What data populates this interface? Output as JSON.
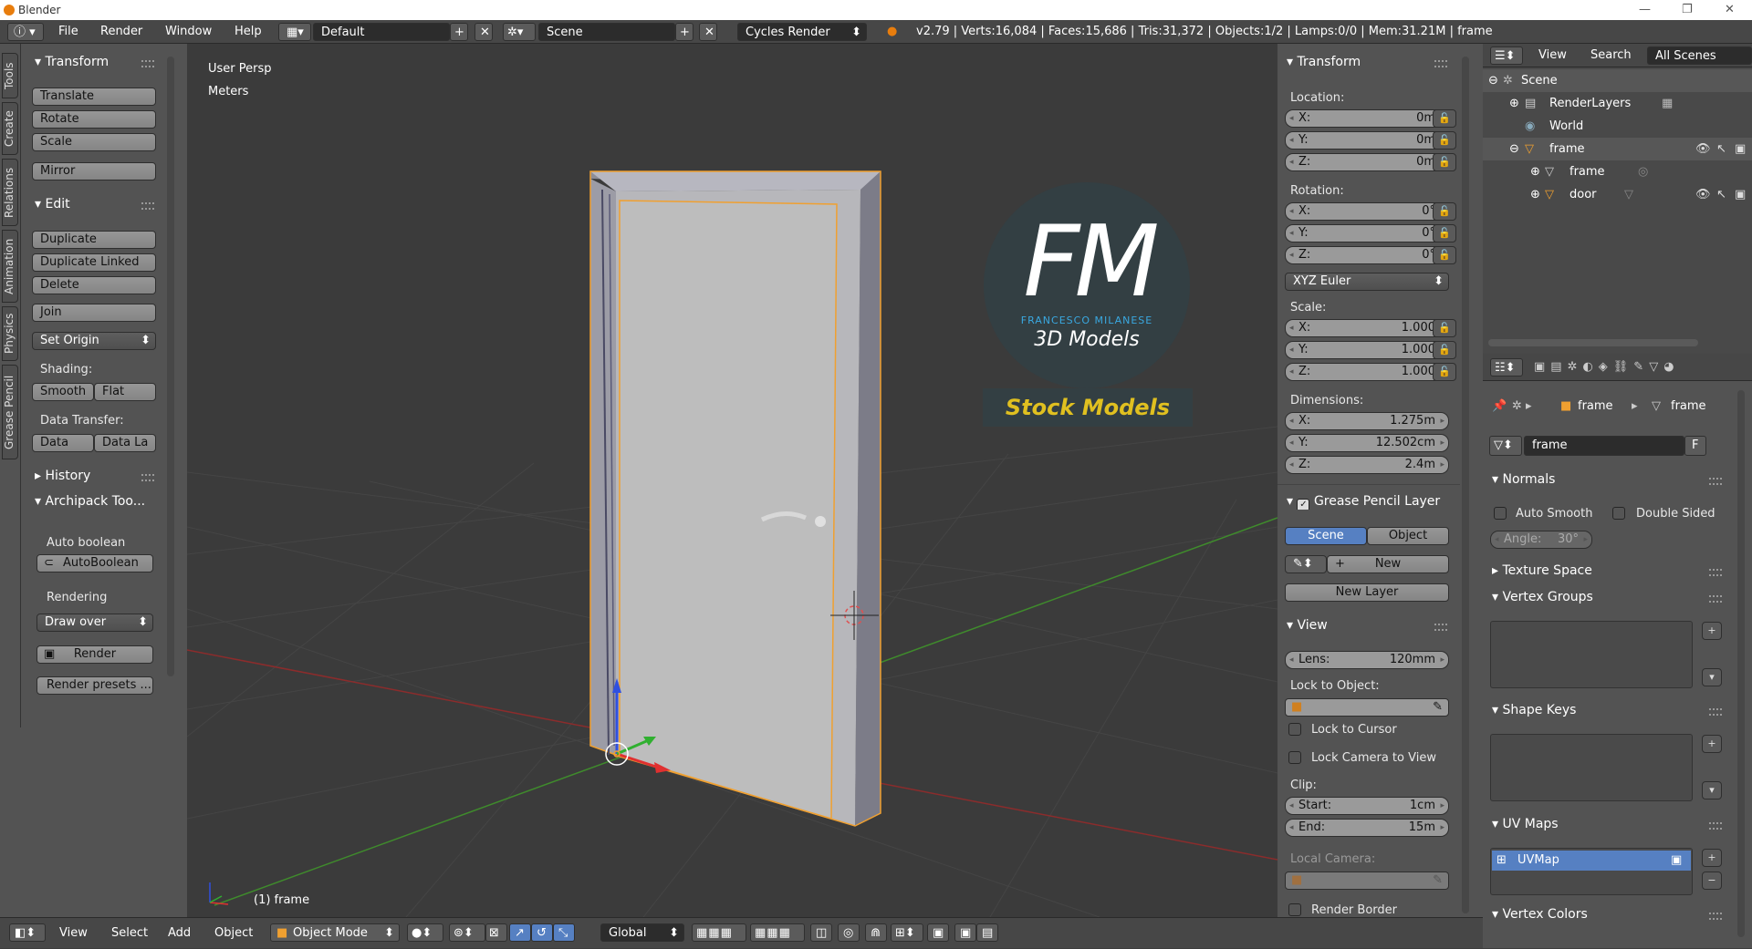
{
  "window": {
    "title": "Blender",
    "controls": [
      "—",
      "❐",
      "✕"
    ]
  },
  "topbar": {
    "menus": [
      "File",
      "Render",
      "Window",
      "Help"
    ],
    "screen_layout": "Default",
    "scene": "Scene",
    "render_engine": "Cycles Render",
    "stats": "v2.79 | Verts:16,084 | Faces:15,686 | Tris:31,372 | Objects:1/2 | Lamps:0/0 | Mem:31.21M | frame"
  },
  "sidetabs": [
    "Tools",
    "Create",
    "Relations",
    "Animation",
    "Physics",
    "Grease Pencil"
  ],
  "toolshelf": {
    "transform": {
      "title": "Transform",
      "buttons": [
        "Translate",
        "Rotate",
        "Scale",
        "Mirror"
      ]
    },
    "edit": {
      "title": "Edit",
      "buttons": [
        "Duplicate",
        "Duplicate Linked",
        "Delete",
        "Join"
      ],
      "set_origin": "Set Origin",
      "shading_label": "Shading:",
      "smooth": "Smooth",
      "flat": "Flat",
      "data_transfer_label": "Data Transfer:",
      "data": "Data",
      "data_la": "Data La"
    },
    "history": {
      "title": "History"
    },
    "archipack": {
      "title": "Archipack Too...",
      "auto_boolean_label": "Auto boolean",
      "auto_boolean_btn": "AutoBoolean",
      "rendering_label": "Rendering",
      "draw_over": "Draw over",
      "render_btn": "Render",
      "render_presets": "Render presets ..."
    }
  },
  "viewport": {
    "view_name": "User Persp",
    "units": "Meters",
    "object_label": "(1) frame",
    "logo": {
      "letters": "FM",
      "name": "FRANCESCO MILANESE",
      "subtitle": "3D Models",
      "banner": "Stock Models"
    },
    "colors": {
      "grid_x": "#8b2c2c",
      "grid_y": "#3f8b2c",
      "selection": "#f0a030"
    }
  },
  "npanel": {
    "transform_title": "Transform",
    "location_label": "Location:",
    "location": [
      {
        "axis": "X:",
        "value": "0m"
      },
      {
        "axis": "Y:",
        "value": "0m"
      },
      {
        "axis": "Z:",
        "value": "0m"
      }
    ],
    "rotation_label": "Rotation:",
    "rotation": [
      {
        "axis": "X:",
        "value": "0°"
      },
      {
        "axis": "Y:",
        "value": "0°"
      },
      {
        "axis": "Z:",
        "value": "0°"
      }
    ],
    "rotation_mode": "XYZ Euler",
    "scale_label": "Scale:",
    "scale": [
      {
        "axis": "X:",
        "value": "1.000"
      },
      {
        "axis": "Y:",
        "value": "1.000"
      },
      {
        "axis": "Z:",
        "value": "1.000"
      }
    ],
    "dimensions_label": "Dimensions:",
    "dimensions": [
      {
        "axis": "X:",
        "value": "1.275m"
      },
      {
        "axis": "Y:",
        "value": "12.502cm"
      },
      {
        "axis": "Z:",
        "value": "2.4m"
      }
    ],
    "grease_pencil_title": "Grease Pencil Layer",
    "gp_scene": "Scene",
    "gp_object": "Object",
    "gp_new": "New",
    "gp_new_layer": "New Layer",
    "view_title": "View",
    "lens_label": "Lens:",
    "lens_value": "120mm",
    "lock_to_object": "Lock to Object:",
    "lock_to_cursor": "Lock to Cursor",
    "lock_camera": "Lock Camera to View",
    "clip_label": "Clip:",
    "clip_start_label": "Start:",
    "clip_start": "1cm",
    "clip_end_label": "End:",
    "clip_end": "15m",
    "local_camera": "Local Camera:",
    "render_border": "Render Border"
  },
  "outliner": {
    "menus": [
      "View",
      "Search"
    ],
    "filter": "All Scenes",
    "items": [
      "Scene",
      "RenderLayers",
      "World",
      "frame",
      "frame",
      "door"
    ]
  },
  "properties": {
    "breadcrumb_object": "frame",
    "breadcrumb_mesh": "frame",
    "mesh_name": "frame",
    "fake_user": "F",
    "normals": "Normals",
    "auto_smooth": "Auto Smooth",
    "double_sided": "Double Sided",
    "angle_label": "Angle:",
    "angle_value": "30°",
    "texture_space": "Texture Space",
    "vertex_groups": "Vertex Groups",
    "shape_keys": "Shape Keys",
    "uv_maps": "UV Maps",
    "uv_map_name": "UVMap",
    "vertex_colors": "Vertex Colors"
  },
  "bottombar": {
    "menus": [
      "View",
      "Select",
      "Add",
      "Object"
    ],
    "mode": "Object Mode",
    "orientation": "Global"
  }
}
